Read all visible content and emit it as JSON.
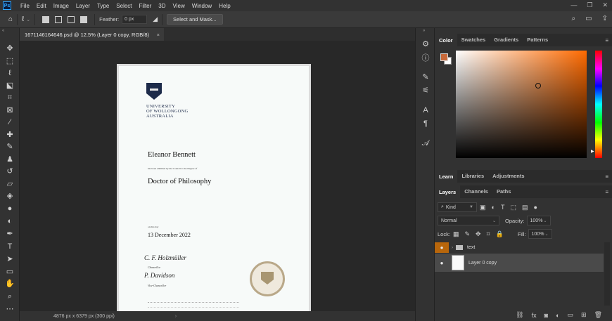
{
  "menubar": {
    "logo": "Ps",
    "items": [
      "File",
      "Edit",
      "Image",
      "Layer",
      "Type",
      "Select",
      "Filter",
      "3D",
      "View",
      "Window",
      "Help"
    ],
    "controls": [
      "—",
      "❐",
      "✕"
    ]
  },
  "optionsbar": {
    "feather_label": "Feather:",
    "feather_value": "0 px",
    "select_mask_label": "Select and Mask..."
  },
  "document": {
    "tab_title": "1671146164646.psd @ 12.5% (Layer 0 copy, RGB/8)",
    "close_glyph": "×",
    "status": "4876 px x 6379 px (300 ppi)",
    "status_chevron": "›"
  },
  "certificate": {
    "university": [
      "UNIVERSITY",
      "OF WOLLONGONG",
      "AUSTRALIA"
    ],
    "name": "Eleanor Bennett",
    "admitted_text": "has been admitted by the Council to the Degree of",
    "degree": "Doctor of Philosophy",
    "on_this_day": "on this day",
    "date": "13 December 2022",
    "chancellor_sig": "C. F. Holzmüller",
    "chancellor_role": "Chancellor",
    "vice_sig": "P. Davidson",
    "vice_role": "Vice-Chancellor"
  },
  "color_panel": {
    "tabs": [
      "Color",
      "Swatches",
      "Gradients",
      "Patterns"
    ],
    "foreground": "#c8693a",
    "background": "#ffffff"
  },
  "learn_panel": {
    "tabs": [
      "Learn",
      "Libraries",
      "Adjustments"
    ]
  },
  "layers_panel": {
    "tabs": [
      "Layers",
      "Channels",
      "Paths"
    ],
    "filter_kind": "Kind",
    "blend_mode": "Normal",
    "opacity_label": "Opacity:",
    "opacity_value": "100%",
    "lock_label": "Lock:",
    "fill_label": "Fill:",
    "fill_value": "100%",
    "layers": [
      {
        "name": "text"
      },
      {
        "name": "Layer 0 copy"
      }
    ],
    "footer_icons": [
      "link-icon",
      "fx-icon",
      "mask-icon",
      "adjustment-icon",
      "group-icon",
      "new-layer-icon",
      "trash-icon"
    ]
  },
  "accent_colors": {
    "selected_eye": "#b8660b",
    "ps_blue": "#31a8ff"
  }
}
